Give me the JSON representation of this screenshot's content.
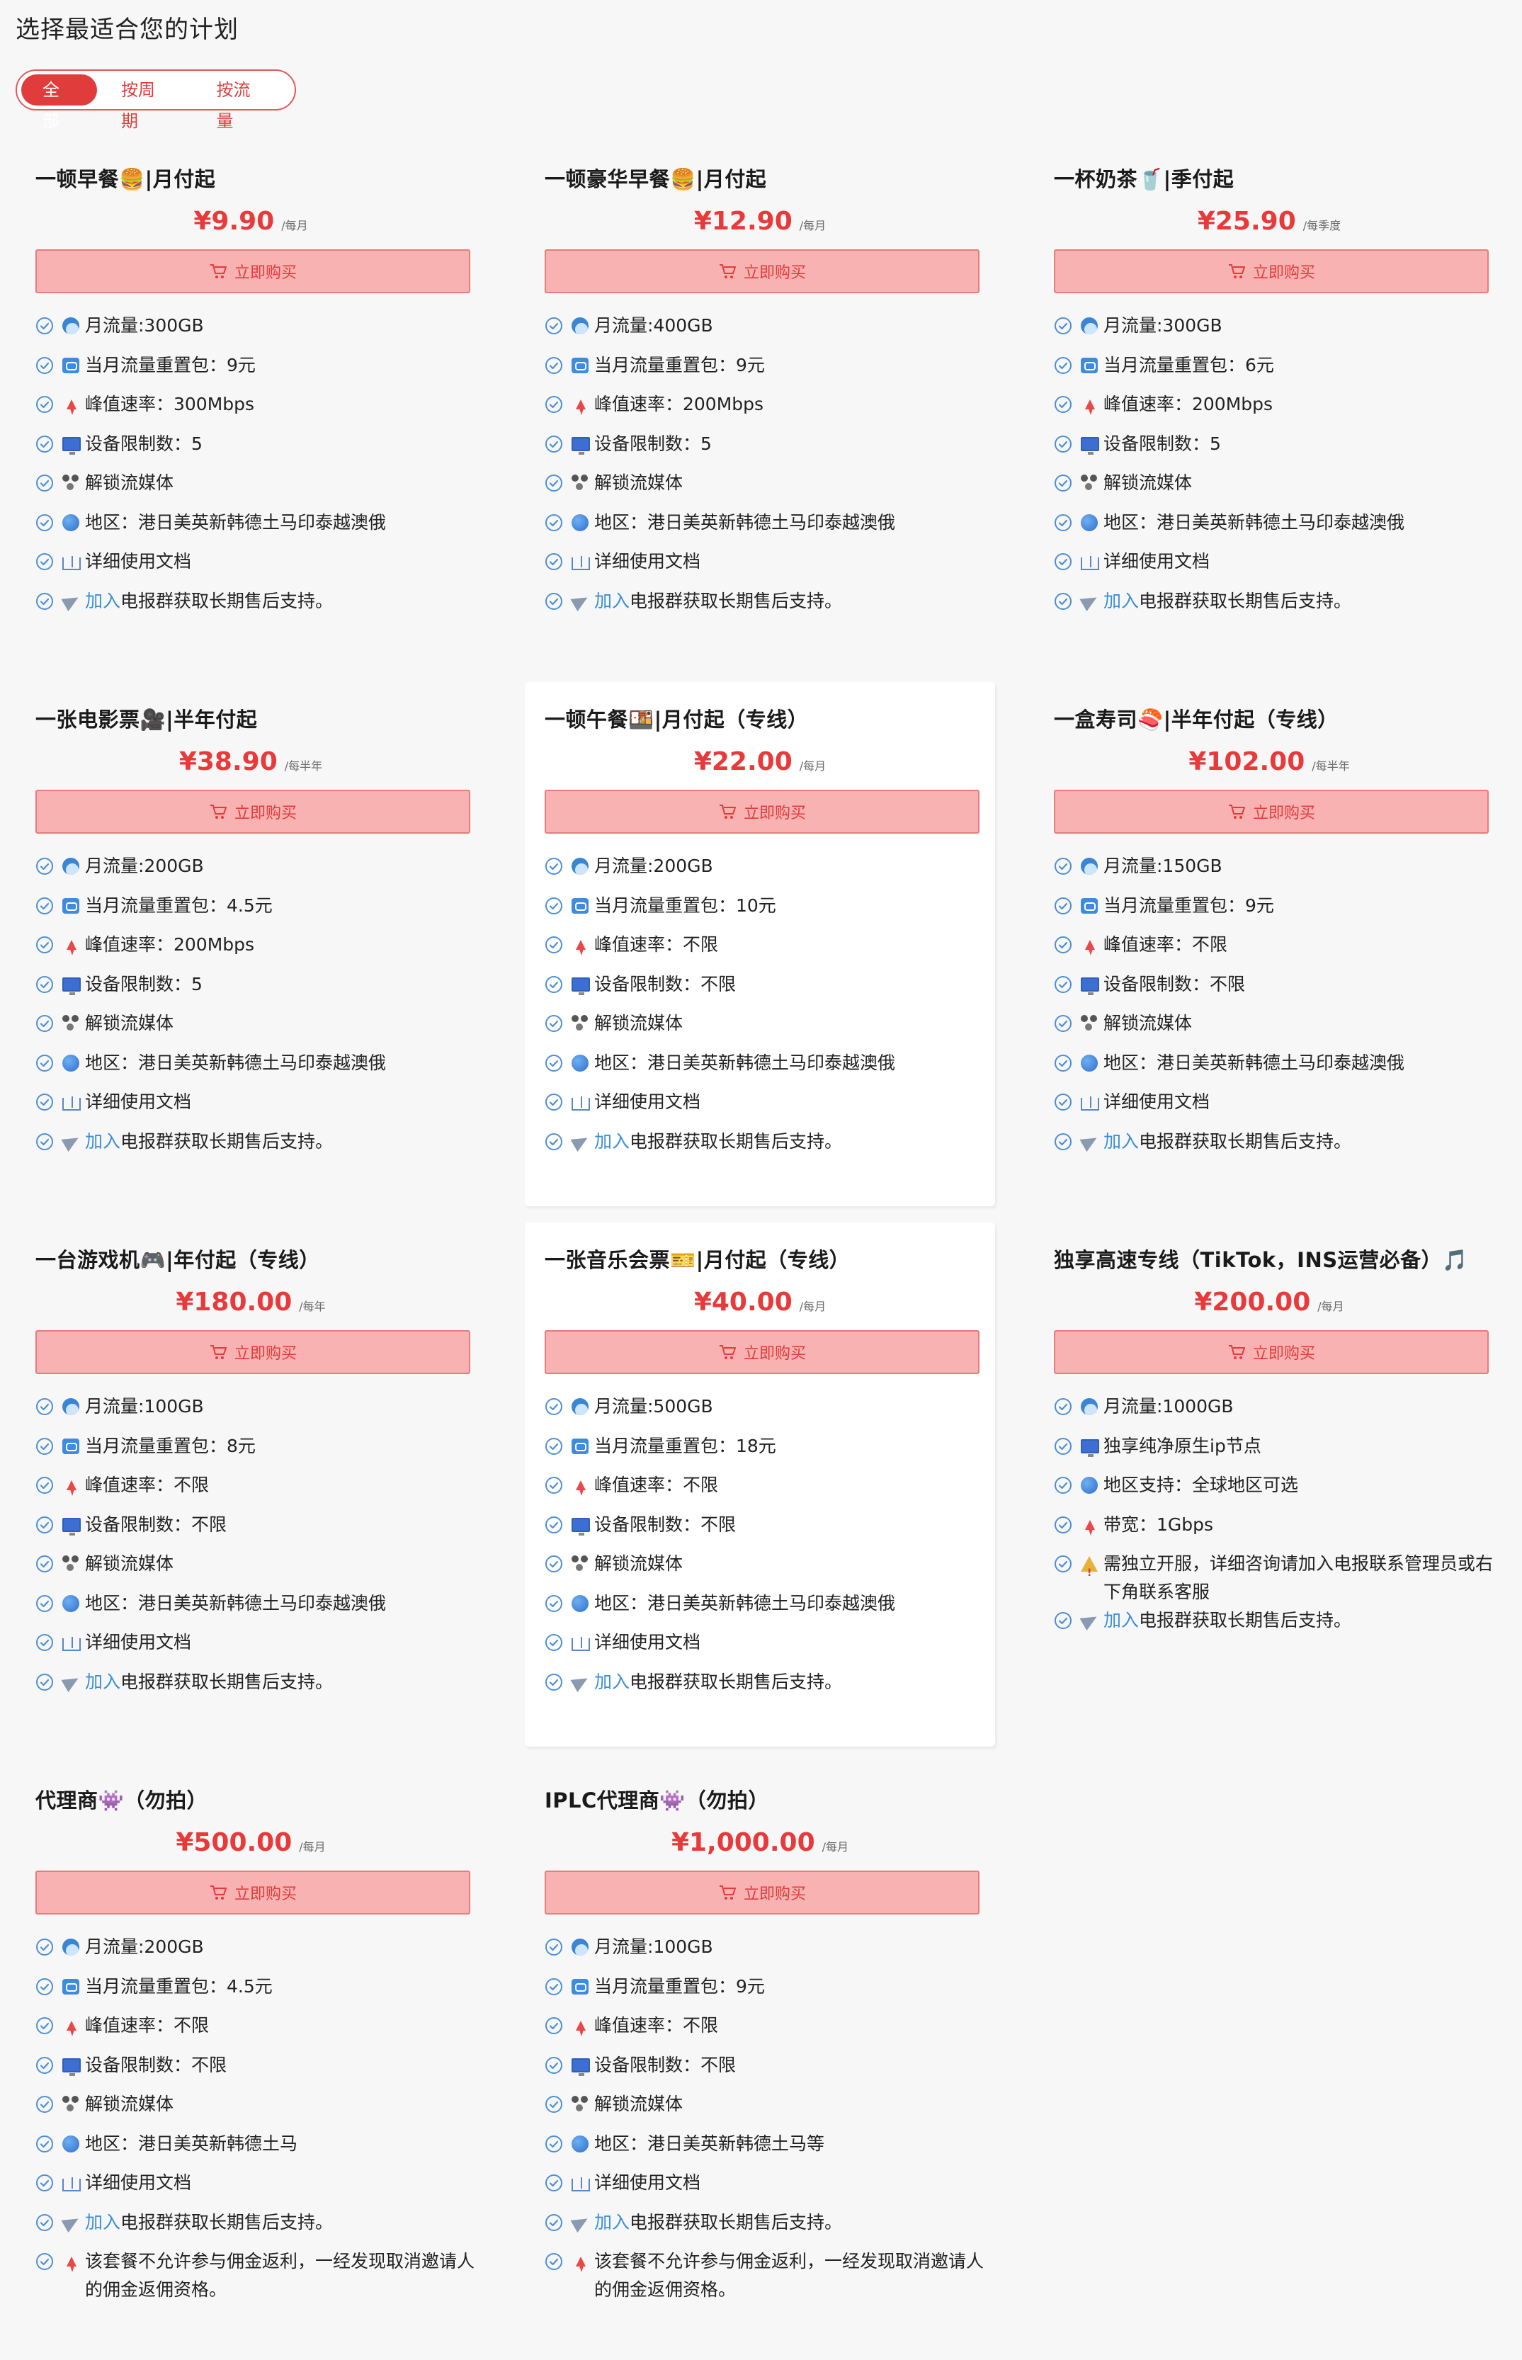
{
  "page": {
    "title": "选择最适合您的计划"
  },
  "filters": {
    "tabs": [
      "全部",
      "按周期",
      "按流量"
    ],
    "active": 0
  },
  "buy_label": "立即购买",
  "plans": [
    {
      "title": "一顿早餐🍔|月付起",
      "price": "¥9.90",
      "period": "/每月",
      "features": [
        {
          "icon": "wave-icon",
          "text": "月流量:300GB"
        },
        {
          "icon": "repeat-icon",
          "text": "当月流量重置包：9元"
        },
        {
          "icon": "bolt-icon",
          "text": "峰值速率：300Mbps"
        },
        {
          "icon": "monitor-icon",
          "text": "设备限制数：5"
        },
        {
          "icon": "film-icon",
          "text": "解锁流媒体"
        },
        {
          "icon": "globe-icon",
          "text": "地区：港日美英新韩德土马印泰越澳俄"
        },
        {
          "icon": "book-icon",
          "text": "详细使用文档"
        },
        {
          "icon": "plane-icon",
          "link": "加入",
          "text": "电报群获取长期售后支持。"
        }
      ]
    },
    {
      "title": "一顿豪华早餐🍔|月付起",
      "price": "¥12.90",
      "period": "/每月",
      "features": [
        {
          "icon": "wave-icon",
          "text": "月流量:400GB"
        },
        {
          "icon": "repeat-icon",
          "text": "当月流量重置包：9元"
        },
        {
          "icon": "bolt-icon",
          "text": "峰值速率：200Mbps"
        },
        {
          "icon": "monitor-icon",
          "text": "设备限制数：5"
        },
        {
          "icon": "film-icon",
          "text": "解锁流媒体"
        },
        {
          "icon": "globe-icon",
          "text": "地区：港日美英新韩德土马印泰越澳俄"
        },
        {
          "icon": "book-icon",
          "text": "详细使用文档"
        },
        {
          "icon": "plane-icon",
          "link": "加入",
          "text": "电报群获取长期售后支持。"
        }
      ]
    },
    {
      "title": "一杯奶茶🥤|季付起",
      "price": "¥25.90",
      "period": "/每季度",
      "features": [
        {
          "icon": "wave-icon",
          "text": "月流量:300GB"
        },
        {
          "icon": "repeat-icon",
          "text": "当月流量重置包：6元"
        },
        {
          "icon": "bolt-icon",
          "text": "峰值速率：200Mbps"
        },
        {
          "icon": "monitor-icon",
          "text": "设备限制数：5"
        },
        {
          "icon": "film-icon",
          "text": "解锁流媒体"
        },
        {
          "icon": "globe-icon",
          "text": "地区：港日美英新韩德土马印泰越澳俄"
        },
        {
          "icon": "book-icon",
          "text": "详细使用文档"
        },
        {
          "icon": "plane-icon",
          "link": "加入",
          "text": "电报群获取长期售后支持。"
        }
      ]
    },
    {
      "title": "一张电影票🎥|半年付起",
      "price": "¥38.90",
      "period": "/每半年",
      "features": [
        {
          "icon": "wave-icon",
          "text": "月流量:200GB"
        },
        {
          "icon": "repeat-icon",
          "text": "当月流量重置包：4.5元"
        },
        {
          "icon": "bolt-icon",
          "text": "峰值速率：200Mbps"
        },
        {
          "icon": "monitor-icon",
          "text": "设备限制数：5"
        },
        {
          "icon": "film-icon",
          "text": "解锁流媒体"
        },
        {
          "icon": "globe-icon",
          "text": "地区：港日美英新韩德土马印泰越澳俄"
        },
        {
          "icon": "book-icon",
          "text": "详细使用文档"
        },
        {
          "icon": "plane-icon",
          "link": "加入",
          "text": "电报群获取长期售后支持。"
        }
      ]
    },
    {
      "title": "一顿午餐🍱|月付起（专线）",
      "price": "¥22.00",
      "period": "/每月",
      "features": [
        {
          "icon": "wave-icon",
          "text": "月流量:200GB"
        },
        {
          "icon": "repeat-icon",
          "text": "当月流量重置包：10元"
        },
        {
          "icon": "bolt-icon",
          "text": "峰值速率：不限"
        },
        {
          "icon": "monitor-icon",
          "text": "设备限制数：不限"
        },
        {
          "icon": "film-icon",
          "text": "解锁流媒体"
        },
        {
          "icon": "globe-icon",
          "text": "地区：港日美英新韩德土马印泰越澳俄"
        },
        {
          "icon": "book-icon",
          "text": "详细使用文档"
        },
        {
          "icon": "plane-icon",
          "link": "加入",
          "text": "电报群获取长期售后支持。"
        }
      ]
    },
    {
      "title": "一盒寿司🍣|半年付起（专线）",
      "price": "¥102.00",
      "period": "/每半年",
      "features": [
        {
          "icon": "wave-icon",
          "text": "月流量:150GB"
        },
        {
          "icon": "repeat-icon",
          "text": "当月流量重置包：9元"
        },
        {
          "icon": "bolt-icon",
          "text": "峰值速率：不限"
        },
        {
          "icon": "monitor-icon",
          "text": "设备限制数：不限"
        },
        {
          "icon": "film-icon",
          "text": "解锁流媒体"
        },
        {
          "icon": "globe-icon",
          "text": "地区：港日美英新韩德土马印泰越澳俄"
        },
        {
          "icon": "book-icon",
          "text": "详细使用文档"
        },
        {
          "icon": "plane-icon",
          "link": "加入",
          "text": "电报群获取长期售后支持。"
        }
      ]
    },
    {
      "title": "一台游戏机🎮|年付起（专线）",
      "price": "¥180.00",
      "period": "/每年",
      "features": [
        {
          "icon": "wave-icon",
          "text": "月流量:100GB"
        },
        {
          "icon": "repeat-icon",
          "text": "当月流量重置包：8元"
        },
        {
          "icon": "bolt-icon",
          "text": "峰值速率：不限"
        },
        {
          "icon": "monitor-icon",
          "text": "设备限制数：不限"
        },
        {
          "icon": "film-icon",
          "text": "解锁流媒体"
        },
        {
          "icon": "globe-icon",
          "text": "地区：港日美英新韩德土马印泰越澳俄"
        },
        {
          "icon": "book-icon",
          "text": "详细使用文档"
        },
        {
          "icon": "plane-icon",
          "link": "加入",
          "text": "电报群获取长期售后支持。"
        }
      ]
    },
    {
      "title": "一张音乐会票🎫|月付起（专线）",
      "price": "¥40.00",
      "period": "/每月",
      "features": [
        {
          "icon": "wave-icon",
          "text": "月流量:500GB"
        },
        {
          "icon": "repeat-icon",
          "text": "当月流量重置包：18元"
        },
        {
          "icon": "bolt-icon",
          "text": "峰值速率：不限"
        },
        {
          "icon": "monitor-icon",
          "text": "设备限制数：不限"
        },
        {
          "icon": "film-icon",
          "text": "解锁流媒体"
        },
        {
          "icon": "globe-icon",
          "text": "地区：港日美英新韩德土马印泰越澳俄"
        },
        {
          "icon": "book-icon",
          "text": "详细使用文档"
        },
        {
          "icon": "plane-icon",
          "link": "加入",
          "text": "电报群获取长期售后支持。"
        }
      ]
    },
    {
      "title": "独享高速专线（TikTok，INS运营必备）🎵",
      "price": "¥200.00",
      "period": "/每月",
      "features": [
        {
          "icon": "wave-icon",
          "text": "月流量:1000GB"
        },
        {
          "icon": "monitor-icon",
          "text": "独享纯净原生ip节点"
        },
        {
          "icon": "globe-icon",
          "text": "地区支持：全球地区可选"
        },
        {
          "icon": "bolt-icon",
          "text": "带宽：1Gbps"
        },
        {
          "icon": "warn-icon",
          "text": "需独立开服，详细咨询请加入电报联系管理员或右下角联系客服"
        },
        {
          "icon": "plane-icon",
          "link": "加入",
          "text": "电报群获取长期售后支持。"
        }
      ]
    },
    {
      "title": "代理商👾（勿拍）",
      "price": "¥500.00",
      "period": "/每月",
      "features": [
        {
          "icon": "wave-icon",
          "text": "月流量:200GB"
        },
        {
          "icon": "repeat-icon",
          "text": "当月流量重置包：4.5元"
        },
        {
          "icon": "bolt-icon",
          "text": "峰值速率：不限"
        },
        {
          "icon": "monitor-icon",
          "text": "设备限制数：不限"
        },
        {
          "icon": "film-icon",
          "text": "解锁流媒体"
        },
        {
          "icon": "globe-icon",
          "text": "地区：港日美英新韩德土马"
        },
        {
          "icon": "book-icon",
          "text": "详细使用文档"
        },
        {
          "icon": "plane-icon",
          "link": "加入",
          "text": "电报群获取长期售后支持。"
        },
        {
          "icon": "bolt-icon",
          "text": "该套餐不允许参与佣金返利，一经发现取消邀请人的佣金返佣资格。"
        }
      ]
    },
    {
      "title": "IPLC代理商👾（勿拍）",
      "price": "¥1,000.00",
      "period": "/每月",
      "features": [
        {
          "icon": "wave-icon",
          "text": "月流量:100GB"
        },
        {
          "icon": "repeat-icon",
          "text": "当月流量重置包：9元"
        },
        {
          "icon": "bolt-icon",
          "text": "峰值速率：不限"
        },
        {
          "icon": "monitor-icon",
          "text": "设备限制数：不限"
        },
        {
          "icon": "film-icon",
          "text": "解锁流媒体"
        },
        {
          "icon": "globe-icon",
          "text": "地区：港日美英新韩德土马等"
        },
        {
          "icon": "book-icon",
          "text": "详细使用文档"
        },
        {
          "icon": "plane-icon",
          "link": "加入",
          "text": "电报群获取长期售后支持。"
        },
        {
          "icon": "bolt-icon",
          "text": "该套餐不允许参与佣金返利，一经发现取消邀请人的佣金返佣资格。"
        }
      ]
    }
  ]
}
